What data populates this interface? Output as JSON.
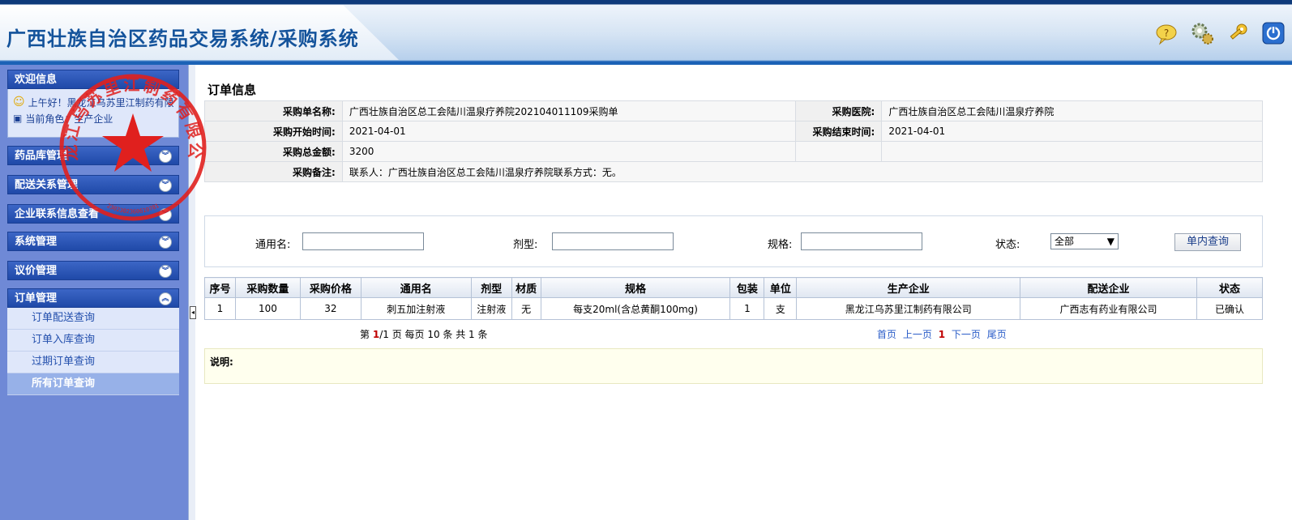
{
  "app": {
    "title": "广西壮族自治区药品交易系统/采购系统"
  },
  "toolbar": {
    "icons": [
      "help-icon",
      "settings-icon",
      "password-key-icon",
      "logout-power-icon"
    ]
  },
  "sidebar": {
    "welcome": {
      "title": "欢迎信息",
      "greeting": "上午好！黑龙江乌苏里江制药有限公司",
      "role": "当前角色：生产企业"
    },
    "menus": [
      "药品库管理",
      "配送关系管理",
      "企业联系信息查看",
      "系统管理",
      "议价管理",
      "订单管理"
    ],
    "order_items": [
      "订单配送查询",
      "订单入库查询",
      "过期订单查询",
      "所有订单查询"
    ]
  },
  "stamp": {
    "text": "黑龙江乌苏里江制药有限公司",
    "code": "2302302360610781",
    "color": "#e0201e"
  },
  "main": {
    "section_title": "订单信息",
    "info": {
      "name_label": "采购单名称:",
      "name_value": "广西壮族自治区总工会陆川温泉疗养院202104011109采购单",
      "hospital_label": "采购医院:",
      "hospital_value": "广西壮族自治区总工会陆川温泉疗养院",
      "start_label": "采购开始时间:",
      "start_value": "2021-04-01",
      "end_label": "采购结束时间:",
      "end_value": "2021-04-01",
      "total_label": "采购总金额:",
      "total_value": "3200",
      "remark_label": "采购备注:",
      "remark_value": "联系人：广西壮族自治区总工会陆川温泉疗养院联系方式：无。"
    },
    "search": {
      "generic_label": "通用名:",
      "form_label": "剂型:",
      "spec_label": "规格:",
      "status_label": "状态:",
      "status_value": "全部",
      "query_button": "单内查询"
    },
    "table": {
      "headers": [
        "序号",
        "采购数量",
        "采购价格",
        "通用名",
        "剂型",
        "材质",
        "规格",
        "包装",
        "单位",
        "生产企业",
        "配送企业",
        "状态"
      ],
      "rows": [
        [
          "1",
          "100",
          "32",
          "刺五加注射液",
          "注射液",
          "无",
          "每支20ml(含总黄酮100mg)",
          "1",
          "支",
          "黑龙江乌苏里江制药有限公司",
          "广西志有药业有限公司",
          "已确认"
        ]
      ]
    },
    "pager": {
      "prefix": "第",
      "page": "1",
      "summary": "/1 页 每页 10 条 共 1 条",
      "first": "首页",
      "prev": "上一页",
      "current": "1",
      "next": "下一页",
      "last": "尾页"
    },
    "note_label": "说明:"
  }
}
